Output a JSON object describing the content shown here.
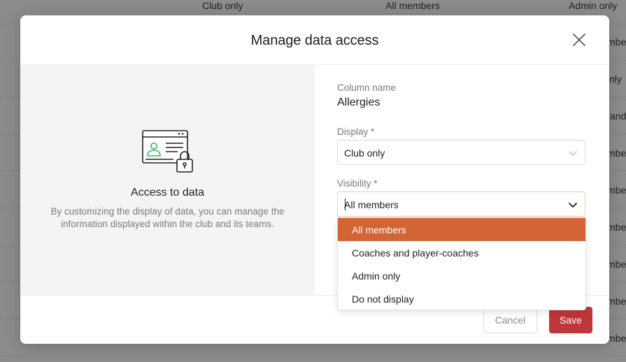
{
  "background_table": {
    "header_cells": [
      "Club only",
      "All members",
      "Admin only"
    ],
    "right_edge_fragments": [
      "mber",
      "nly",
      "and",
      "mber",
      "mber",
      "mber",
      "mber",
      "mber",
      "mber",
      "mber"
    ]
  },
  "modal": {
    "title": "Manage data access",
    "left_panel": {
      "title": "Access to data",
      "description": "By customizing the display of data, you can manage the information displayed within the club and its teams."
    },
    "form": {
      "column_name_label": "Column name",
      "column_name_value": "Allergies",
      "display_label": "Display *",
      "display_value": "Club only",
      "visibility_label": "Visibility *",
      "visibility_value": "All members",
      "visibility_options": [
        "All members",
        "Coaches and player-coaches",
        "Admin only",
        "Do not display"
      ]
    },
    "footer": {
      "cancel_label": "Cancel",
      "save_label": "Save"
    }
  },
  "colors": {
    "accent_orange": "#d36434",
    "save_red": "#c0363a"
  }
}
